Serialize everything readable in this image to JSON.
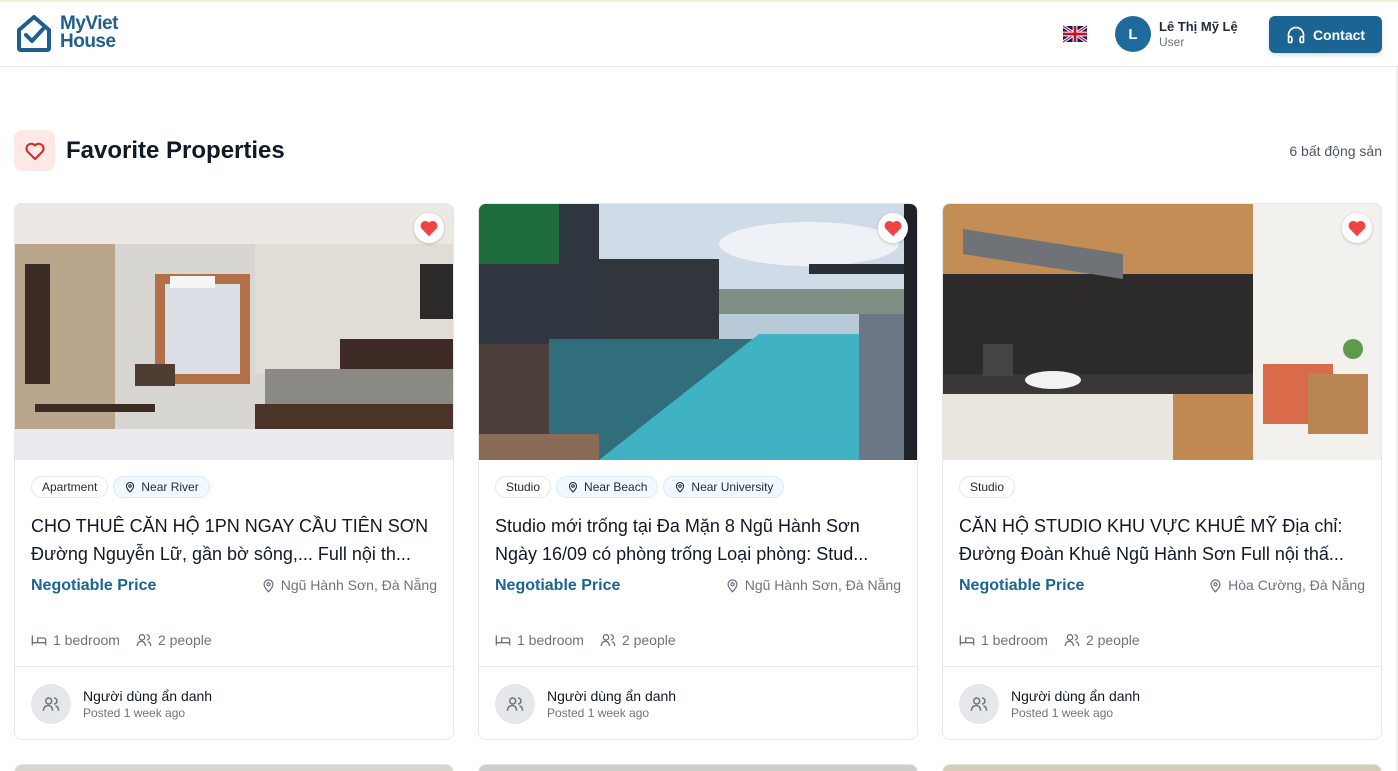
{
  "brand": {
    "logo_line1": "MyViet",
    "logo_line2": "House"
  },
  "header": {
    "language_icon": "uk-flag-icon",
    "user": {
      "initial": "L",
      "name": "Lê Thị Mỹ Lệ",
      "role": "User"
    },
    "contact_label": "Contact"
  },
  "page": {
    "title": "Favorite Properties",
    "count": "6 bất động sản"
  },
  "colors": {
    "brand": "#1b6494",
    "favorite": "#ef4444",
    "price": "#1b6494"
  },
  "cards": [
    {
      "tags": [
        {
          "label": "Apartment",
          "type": "type"
        },
        {
          "label": "Near River",
          "type": "location"
        }
      ],
      "title": "CHO THUÊ CĂN HỘ 1PN NGAY CẦU TIÊN SƠN Đường Nguyễn Lữ, gần bờ sông,... Full nội th...",
      "price": "Negotiable Price",
      "location": "Ngũ Hành Sơn, Đà Nẵng",
      "bedrooms": "1 bedroom",
      "people": "2 people",
      "poster_name": "Người dùng ẩn danh",
      "posted": "Posted 1 week ago"
    },
    {
      "tags": [
        {
          "label": "Studio",
          "type": "type"
        },
        {
          "label": "Near Beach",
          "type": "location"
        },
        {
          "label": "Near University",
          "type": "location"
        }
      ],
      "title": "Studio mới trống tại Đa Mặn 8 Ngũ Hành Sơn Ngày 16/09 có phòng trống Loại phòng: Stud...",
      "price": "Negotiable Price",
      "location": "Ngũ Hành Sơn, Đà Nẵng",
      "bedrooms": "1 bedroom",
      "people": "2 people",
      "poster_name": "Người dùng ẩn danh",
      "posted": "Posted 1 week ago"
    },
    {
      "tags": [
        {
          "label": "Studio",
          "type": "type"
        }
      ],
      "title": "CĂN HỘ STUDIO KHU VỰC KHUÊ MỸ Địa chỉ: Đường Đoàn Khuê Ngũ Hành Sơn Full nội thấ...",
      "price": "Negotiable Price",
      "location": "Hòa Cường, Đà Nẵng",
      "bedrooms": "1 bedroom",
      "people": "2 people",
      "poster_name": "Người dùng ẩn danh",
      "posted": "Posted 1 week ago"
    }
  ]
}
